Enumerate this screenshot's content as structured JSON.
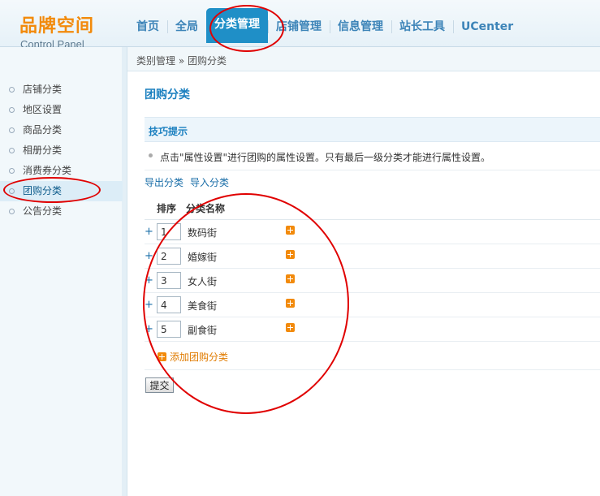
{
  "header": {
    "logo_title": "品牌空间",
    "logo_subtitle": "Control Panel",
    "nav": [
      {
        "label": "首页",
        "active": false
      },
      {
        "label": "全局",
        "active": false
      },
      {
        "label": "分类管理",
        "active": true
      },
      {
        "label": "店铺管理",
        "active": false
      },
      {
        "label": "信息管理",
        "active": false
      },
      {
        "label": "站长工具",
        "active": false
      },
      {
        "label": "UCenter",
        "active": false
      }
    ]
  },
  "breadcrumb": "类别管理 » 团购分类",
  "sidebar": {
    "items": [
      {
        "label": "店铺分类",
        "active": false
      },
      {
        "label": "地区设置",
        "active": false
      },
      {
        "label": "商品分类",
        "active": false
      },
      {
        "label": "相册分类",
        "active": false
      },
      {
        "label": "消费券分类",
        "active": false
      },
      {
        "label": "团购分类",
        "active": true
      },
      {
        "label": "公告分类",
        "active": false
      }
    ]
  },
  "main": {
    "title": "团购分类",
    "tips_title": "技巧提示",
    "tip_text": "点击\"属性设置\"进行团购的属性设置。只有最后一级分类才能进行属性设置。",
    "export_link": "导出分类",
    "import_link": "导入分类",
    "table_headers": {
      "order": "排序",
      "name": "分类名称"
    },
    "rows": [
      {
        "order": "1",
        "name": "数码街"
      },
      {
        "order": "2",
        "name": "婚嫁街"
      },
      {
        "order": "3",
        "name": "女人街"
      },
      {
        "order": "4",
        "name": "美食街"
      },
      {
        "order": "5",
        "name": "副食街"
      }
    ],
    "add_label": "添加团购分类",
    "submit_label": "提交"
  },
  "colors": {
    "accent": "#1f8fc7",
    "logo": "#f28a0b",
    "annotation": "#e00000"
  }
}
